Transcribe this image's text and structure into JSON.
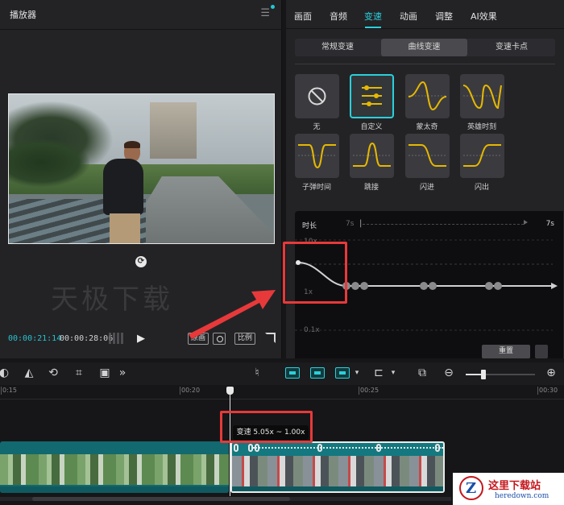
{
  "player": {
    "title": "播放器",
    "watermark": "天极下载",
    "timecode_current": "00:00:21:14",
    "timecode_total": "00:00:28:06",
    "btn_original": "原画",
    "btn_ratio": "比例"
  },
  "tabs": [
    "画面",
    "音频",
    "变速",
    "动画",
    "调整",
    "AI效果"
  ],
  "active_tab": "变速",
  "subtabs": [
    "常规变速",
    "曲线变速",
    "变速卡点"
  ],
  "active_subtab": "曲线变速",
  "presets": [
    "无",
    "自定义",
    "蒙太奇",
    "英雄时刻",
    "子弹时间",
    "跳接",
    "闪进",
    "闪出"
  ],
  "selected_preset": "自定义",
  "curve": {
    "duration_label": "时长",
    "duration_min": "7s",
    "duration_value": "7s",
    "y_labels": [
      "10x",
      "1x",
      "0.1x"
    ],
    "reset_label": "重置"
  },
  "ruler": [
    "0:15",
    "00:20",
    "00:25",
    "00:30"
  ],
  "tooltip": "变速 5.05x ~ 1.00x",
  "logo": {
    "title": "这里下载站",
    "sub": "heredown.com"
  },
  "colors": {
    "accent": "#2ad0dc",
    "highlight_box": "#e8393a",
    "curve_yellow": "#e6b800"
  }
}
